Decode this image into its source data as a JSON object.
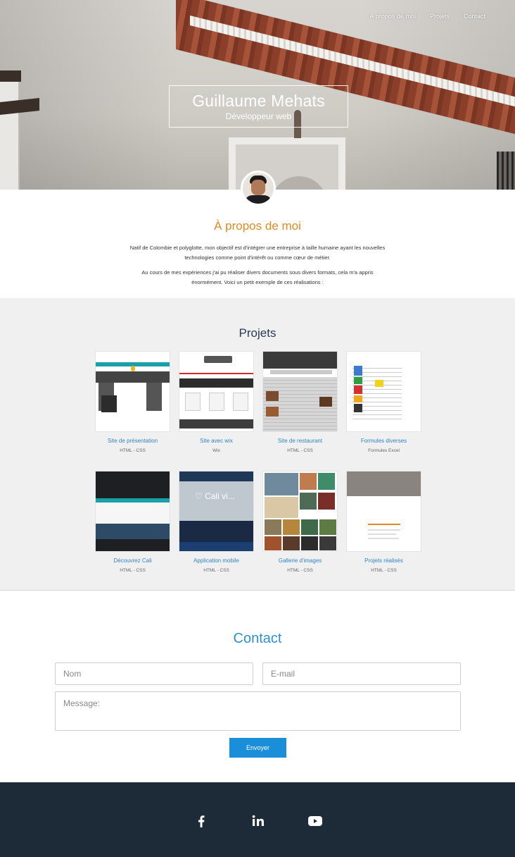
{
  "nav": {
    "items": [
      {
        "label": "À propos de moi"
      },
      {
        "label": "Projets"
      },
      {
        "label": "Contact"
      }
    ]
  },
  "hero": {
    "name": "Guillaume Mehats",
    "subtitle": "Développeur web"
  },
  "about": {
    "title": "À propos de moi",
    "p1": "Natif de Colombie et polyglotte, mon objectif est d'intégrer une entreprise à taille humaine ayant les nouvelles technologies comme point d'intérêt ou comme cœur de métier.",
    "p2": "Au cours de mes expériences j'ai pu réaliser divers documents sous divers formats, cela m'a appris énormément. Voici un petit exemple de ces réalisations :"
  },
  "projects": {
    "title": "Projets",
    "items": [
      {
        "name": "Site de présentation",
        "tech": "HTML - CSS"
      },
      {
        "name": "Site avec wix",
        "tech": "Wix"
      },
      {
        "name": "Site de restaurant",
        "tech": "HTML - CSS"
      },
      {
        "name": "Formules diverses",
        "tech": "Formules Excel"
      },
      {
        "name": "Découvrez Cali",
        "tech": "HTML - CSS"
      },
      {
        "name": "Application mobile",
        "tech": "HTML - CSS"
      },
      {
        "name": "Gallerie d'images",
        "tech": "HTML - CSS"
      },
      {
        "name": "Projets réalisés",
        "tech": "HTML - CSS"
      }
    ]
  },
  "contact": {
    "title": "Contact",
    "name_placeholder": "Nom",
    "email_placeholder": "E-mail",
    "message_placeholder": "Message:",
    "send_label": "Envoyer"
  },
  "footer": {
    "social": [
      {
        "icon": "facebook-icon"
      },
      {
        "icon": "linkedin-icon"
      },
      {
        "icon": "youtube-icon"
      }
    ]
  },
  "colors": {
    "accent_orange": "#e08a23",
    "accent_blue": "#2f90d0",
    "projects_title": "#2a3a58",
    "footer_bg": "#1d2a38",
    "button_bg": "#1a8ed8"
  }
}
